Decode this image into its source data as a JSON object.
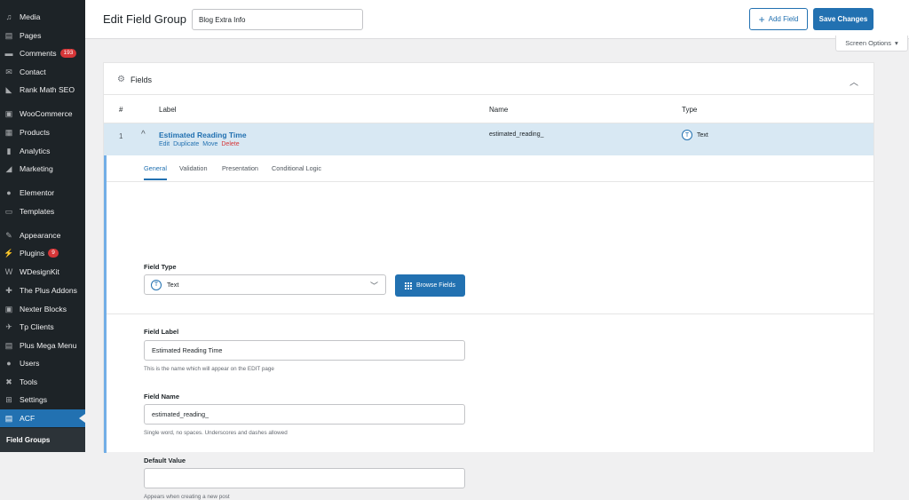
{
  "sidebar": {
    "items": [
      {
        "label": "Media",
        "icon": "media-icon",
        "glyph": "♫"
      },
      {
        "label": "Pages",
        "icon": "pages-icon",
        "glyph": "▤"
      },
      {
        "label": "Comments",
        "icon": "comments-icon",
        "glyph": "▬",
        "badge": "193"
      },
      {
        "label": "Contact",
        "icon": "contact-icon",
        "glyph": "✉"
      },
      {
        "label": "Rank Math SEO",
        "icon": "rank-math-icon",
        "glyph": "◣"
      },
      {
        "label": "WooCommerce",
        "icon": "woocommerce-icon",
        "glyph": "▣"
      },
      {
        "label": "Products",
        "icon": "products-icon",
        "glyph": "▦"
      },
      {
        "label": "Analytics",
        "icon": "analytics-icon",
        "glyph": "▮"
      },
      {
        "label": "Marketing",
        "icon": "marketing-icon",
        "glyph": "◢"
      },
      {
        "label": "Elementor",
        "icon": "elementor-icon",
        "glyph": "●"
      },
      {
        "label": "Templates",
        "icon": "templates-icon",
        "glyph": "▭"
      },
      {
        "label": "Appearance",
        "icon": "appearance-icon",
        "glyph": "✎"
      },
      {
        "label": "Plugins",
        "icon": "plugins-icon",
        "glyph": "⚡",
        "badge": "9"
      },
      {
        "label": "WDesignKit",
        "icon": "wdesignkit-icon",
        "glyph": "W"
      },
      {
        "label": "The Plus Addons",
        "icon": "plus-addons-icon",
        "glyph": "✚"
      },
      {
        "label": "Nexter Blocks",
        "icon": "nexter-icon",
        "glyph": "▣"
      },
      {
        "label": "Tp Clients",
        "icon": "pin-icon",
        "glyph": "✈"
      },
      {
        "label": "Plus Mega Menu",
        "icon": "mega-menu-icon",
        "glyph": "▤"
      },
      {
        "label": "Users",
        "icon": "users-icon",
        "glyph": "●"
      },
      {
        "label": "Tools",
        "icon": "tools-icon",
        "glyph": "✖"
      },
      {
        "label": "Settings",
        "icon": "settings-icon",
        "glyph": "⊞"
      },
      {
        "label": "ACF",
        "icon": "acf-icon",
        "glyph": "▤",
        "active": true
      }
    ],
    "submenu_label": "Field Groups"
  },
  "header": {
    "title": "Edit Field Group",
    "group_name": "Blog Extra Info",
    "add_field_label": "Add Field",
    "save_label": "Save Changes",
    "screen_options_label": "Screen Options"
  },
  "panel": {
    "title": "Fields",
    "columns": {
      "num": "#",
      "label": "Label",
      "name": "Name",
      "type": "Type"
    },
    "row": {
      "num": "1",
      "label": "Estimated Reading Time",
      "actions": {
        "edit": "Edit",
        "duplicate": "Duplicate",
        "move": "Move",
        "delete": "Delete"
      },
      "name": "estimated_reading_",
      "type": "Text"
    },
    "tabs": [
      "General",
      "Validation",
      "Presentation",
      "Conditional Logic"
    ],
    "field_type": {
      "label": "Field Type",
      "value": "Text",
      "browse_label": "Browse Fields"
    },
    "field_label": {
      "label": "Field Label",
      "value": "Estimated Reading Time",
      "hint": "This is the name which will appear on the EDIT page"
    },
    "field_name": {
      "label": "Field Name",
      "value": "estimated_reading_",
      "hint": "Single word, no spaces. Underscores and dashes allowed"
    },
    "default_value": {
      "label": "Default Value",
      "value": "",
      "hint": "Appears when creating a new post"
    }
  },
  "colors": {
    "accent": "#2271b1",
    "sidebar_bg": "#1d2327",
    "row_highlight": "#d8e8f3",
    "badge": "#d63638"
  }
}
